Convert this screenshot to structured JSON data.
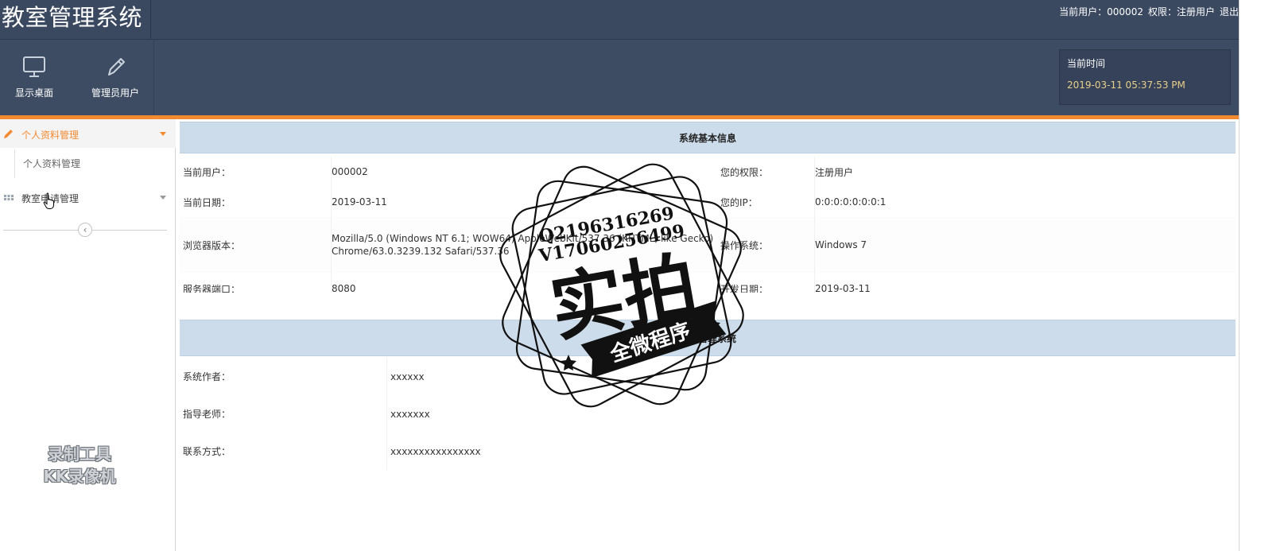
{
  "header": {
    "app_title": "教室管理系统",
    "current_user": "当前用户：000002",
    "permission": "权限：注册用户",
    "logout_label": "退出"
  },
  "toolbar": {
    "buttons": [
      {
        "label": "显示桌面",
        "icon": "monitor-icon"
      },
      {
        "label": "管理员用户",
        "icon": "pencil-icon"
      }
    ],
    "clock_label": "当前时间",
    "clock_value": "2019-03-11 05:37:53 PM"
  },
  "sidebar": {
    "groups": [
      {
        "label": "个人资料管理",
        "icon": "pencil-icon",
        "expanded": true,
        "items": [
          {
            "label": "个人资料管理"
          }
        ]
      },
      {
        "label": "教室申请管理",
        "icon": "grid-icon",
        "expanded": false,
        "items": []
      }
    ],
    "collapse_icon": "chevron-left-icon"
  },
  "system_info": {
    "title": "系统基本信息",
    "rows": [
      {
        "label": "当前用户：",
        "value": "000002",
        "label2": "您的权限：",
        "value2": "注册用户"
      },
      {
        "label": "当前日期：",
        "value": "2019-03-11",
        "label2": "您的IP：",
        "value2": "0:0:0:0:0:0:0:1"
      },
      {
        "label": "浏览器版本：",
        "value": "Mozilla/5.0 (Windows NT 6.1; WOW64) AppleWebKit/537.36 (KHTML, like Gecko)",
        "value_line2": "Chrome/63.0.3239.132 Safari/537.36",
        "label2": "操作系统：",
        "value2": "Windows 7"
      },
      {
        "label": "服务器端口：",
        "value": "8080",
        "label2": "开发日期：",
        "value2": "2019-03-11"
      }
    ]
  },
  "dev_info": {
    "title": "教室管理系统",
    "rows": [
      {
        "label": "系统作者：",
        "value": "xxxxxx"
      },
      {
        "label": "指导老师：",
        "value": "xxxxxxx"
      },
      {
        "label": "联系方式：",
        "value": "xxxxxxxxxxxxxxxx"
      }
    ]
  },
  "overlay": {
    "stamp_line1": "Q2196316269",
    "stamp_line2": "V17060256499",
    "stamp_big": "实拍",
    "stamp_banner": "全微程序",
    "recorder_line1": "录制工具",
    "recorder_line2": "KK录像机"
  },
  "colors": {
    "header_bg": "#3a4860",
    "toolbar_bg": "#3e4c63",
    "accent_orange": "#f28a32",
    "clock_text": "#e9cf8a",
    "section_head_bg": "#ccdcea"
  }
}
